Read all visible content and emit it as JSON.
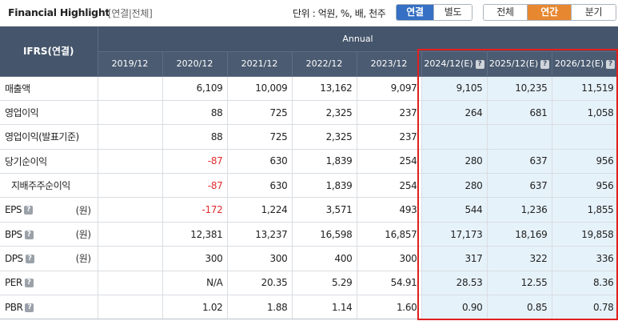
{
  "header": {
    "title": "Financial Highlight",
    "subtitle": "[연결|전체]",
    "unit": "단위 : 억원, %, 배, 천주",
    "scope_buttons": [
      {
        "label": "연결",
        "active": true
      },
      {
        "label": "별도",
        "active": false
      }
    ],
    "period_buttons": [
      {
        "label": "전체",
        "active": false
      },
      {
        "label": "연간",
        "active": true
      },
      {
        "label": "분기",
        "active": false
      }
    ]
  },
  "table": {
    "corner_label": "IFRS(연결)",
    "group_label": "Annual",
    "columns": [
      "2019/12",
      "2020/12",
      "2021/12",
      "2022/12",
      "2023/12",
      "2024/12(E)",
      "2025/12(E)",
      "2026/12(E)"
    ],
    "estimate_help_icon": "question-icon",
    "unit_won": "(원)",
    "rows": [
      {
        "label": "매출액",
        "values": [
          "",
          "6,109",
          "10,009",
          "13,162",
          "9,097",
          "9,105",
          "10,235",
          "11,519"
        ]
      },
      {
        "label": "영업이익",
        "values": [
          "",
          "88",
          "725",
          "2,325",
          "237",
          "264",
          "681",
          "1,058"
        ]
      },
      {
        "label": "영업이익(발표기준)",
        "values": [
          "",
          "88",
          "725",
          "2,325",
          "237",
          "",
          "",
          ""
        ]
      },
      {
        "label": "당기순이익",
        "values": [
          "",
          "-87",
          "630",
          "1,839",
          "254",
          "280",
          "637",
          "956"
        ]
      },
      {
        "label": "지배주주순이익",
        "values": [
          "",
          "-87",
          "630",
          "1,839",
          "254",
          "280",
          "637",
          "956"
        ]
      },
      {
        "label": "EPS",
        "values": [
          "",
          "-172",
          "1,224",
          "3,571",
          "493",
          "544",
          "1,236",
          "1,855"
        ]
      },
      {
        "label": "BPS",
        "values": [
          "",
          "12,381",
          "13,237",
          "16,598",
          "16,857",
          "17,173",
          "18,169",
          "19,858"
        ]
      },
      {
        "label": "DPS",
        "values": [
          "",
          "300",
          "300",
          "400",
          "300",
          "317",
          "322",
          "336"
        ]
      },
      {
        "label": "PER",
        "values": [
          "",
          "N/A",
          "20.35",
          "5.29",
          "54.91",
          "28.53",
          "12.55",
          "8.36"
        ]
      },
      {
        "label": "PBR",
        "values": [
          "",
          "1.02",
          "1.88",
          "1.14",
          "1.60",
          "0.90",
          "0.85",
          "0.78"
        ]
      }
    ]
  },
  "colors": {
    "header_bg": "#45556b",
    "estimate_bg": "#e6f2fa",
    "negative": "#e02c2c",
    "highlight_frame": "#e0201f",
    "active_scope": "#3570c4",
    "active_period": "#e7872f"
  }
}
